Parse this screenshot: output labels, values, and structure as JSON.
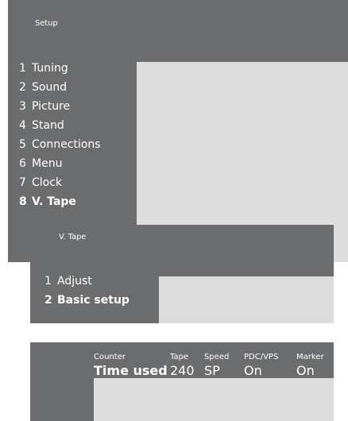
{
  "setup": {
    "title": "Setup",
    "items": [
      {
        "num": "1",
        "label": "Tuning"
      },
      {
        "num": "2",
        "label": "Sound"
      },
      {
        "num": "3",
        "label": "Picture"
      },
      {
        "num": "4",
        "label": "Stand"
      },
      {
        "num": "5",
        "label": "Connections"
      },
      {
        "num": "6",
        "label": "Menu"
      },
      {
        "num": "7",
        "label": "Clock"
      },
      {
        "num": "8",
        "label": "V. Tape"
      }
    ],
    "active_index": 7
  },
  "vtape": {
    "title": "V. Tape",
    "items": [
      {
        "num": "1",
        "label": "Adjust"
      },
      {
        "num": "2",
        "label": "Basic setup"
      }
    ],
    "active_index": 1
  },
  "status": {
    "columns": [
      {
        "header": "Counter",
        "value": "Time used"
      },
      {
        "header": "Tape",
        "value": "240"
      },
      {
        "header": "Speed",
        "value": "SP"
      },
      {
        "header": "PDC/VPS",
        "value": "On"
      },
      {
        "header": "Marker",
        "value": "On"
      }
    ]
  },
  "colors": {
    "panel": "#6b6c6e",
    "screen": "#dcdcdd",
    "text": "#ffffff"
  }
}
